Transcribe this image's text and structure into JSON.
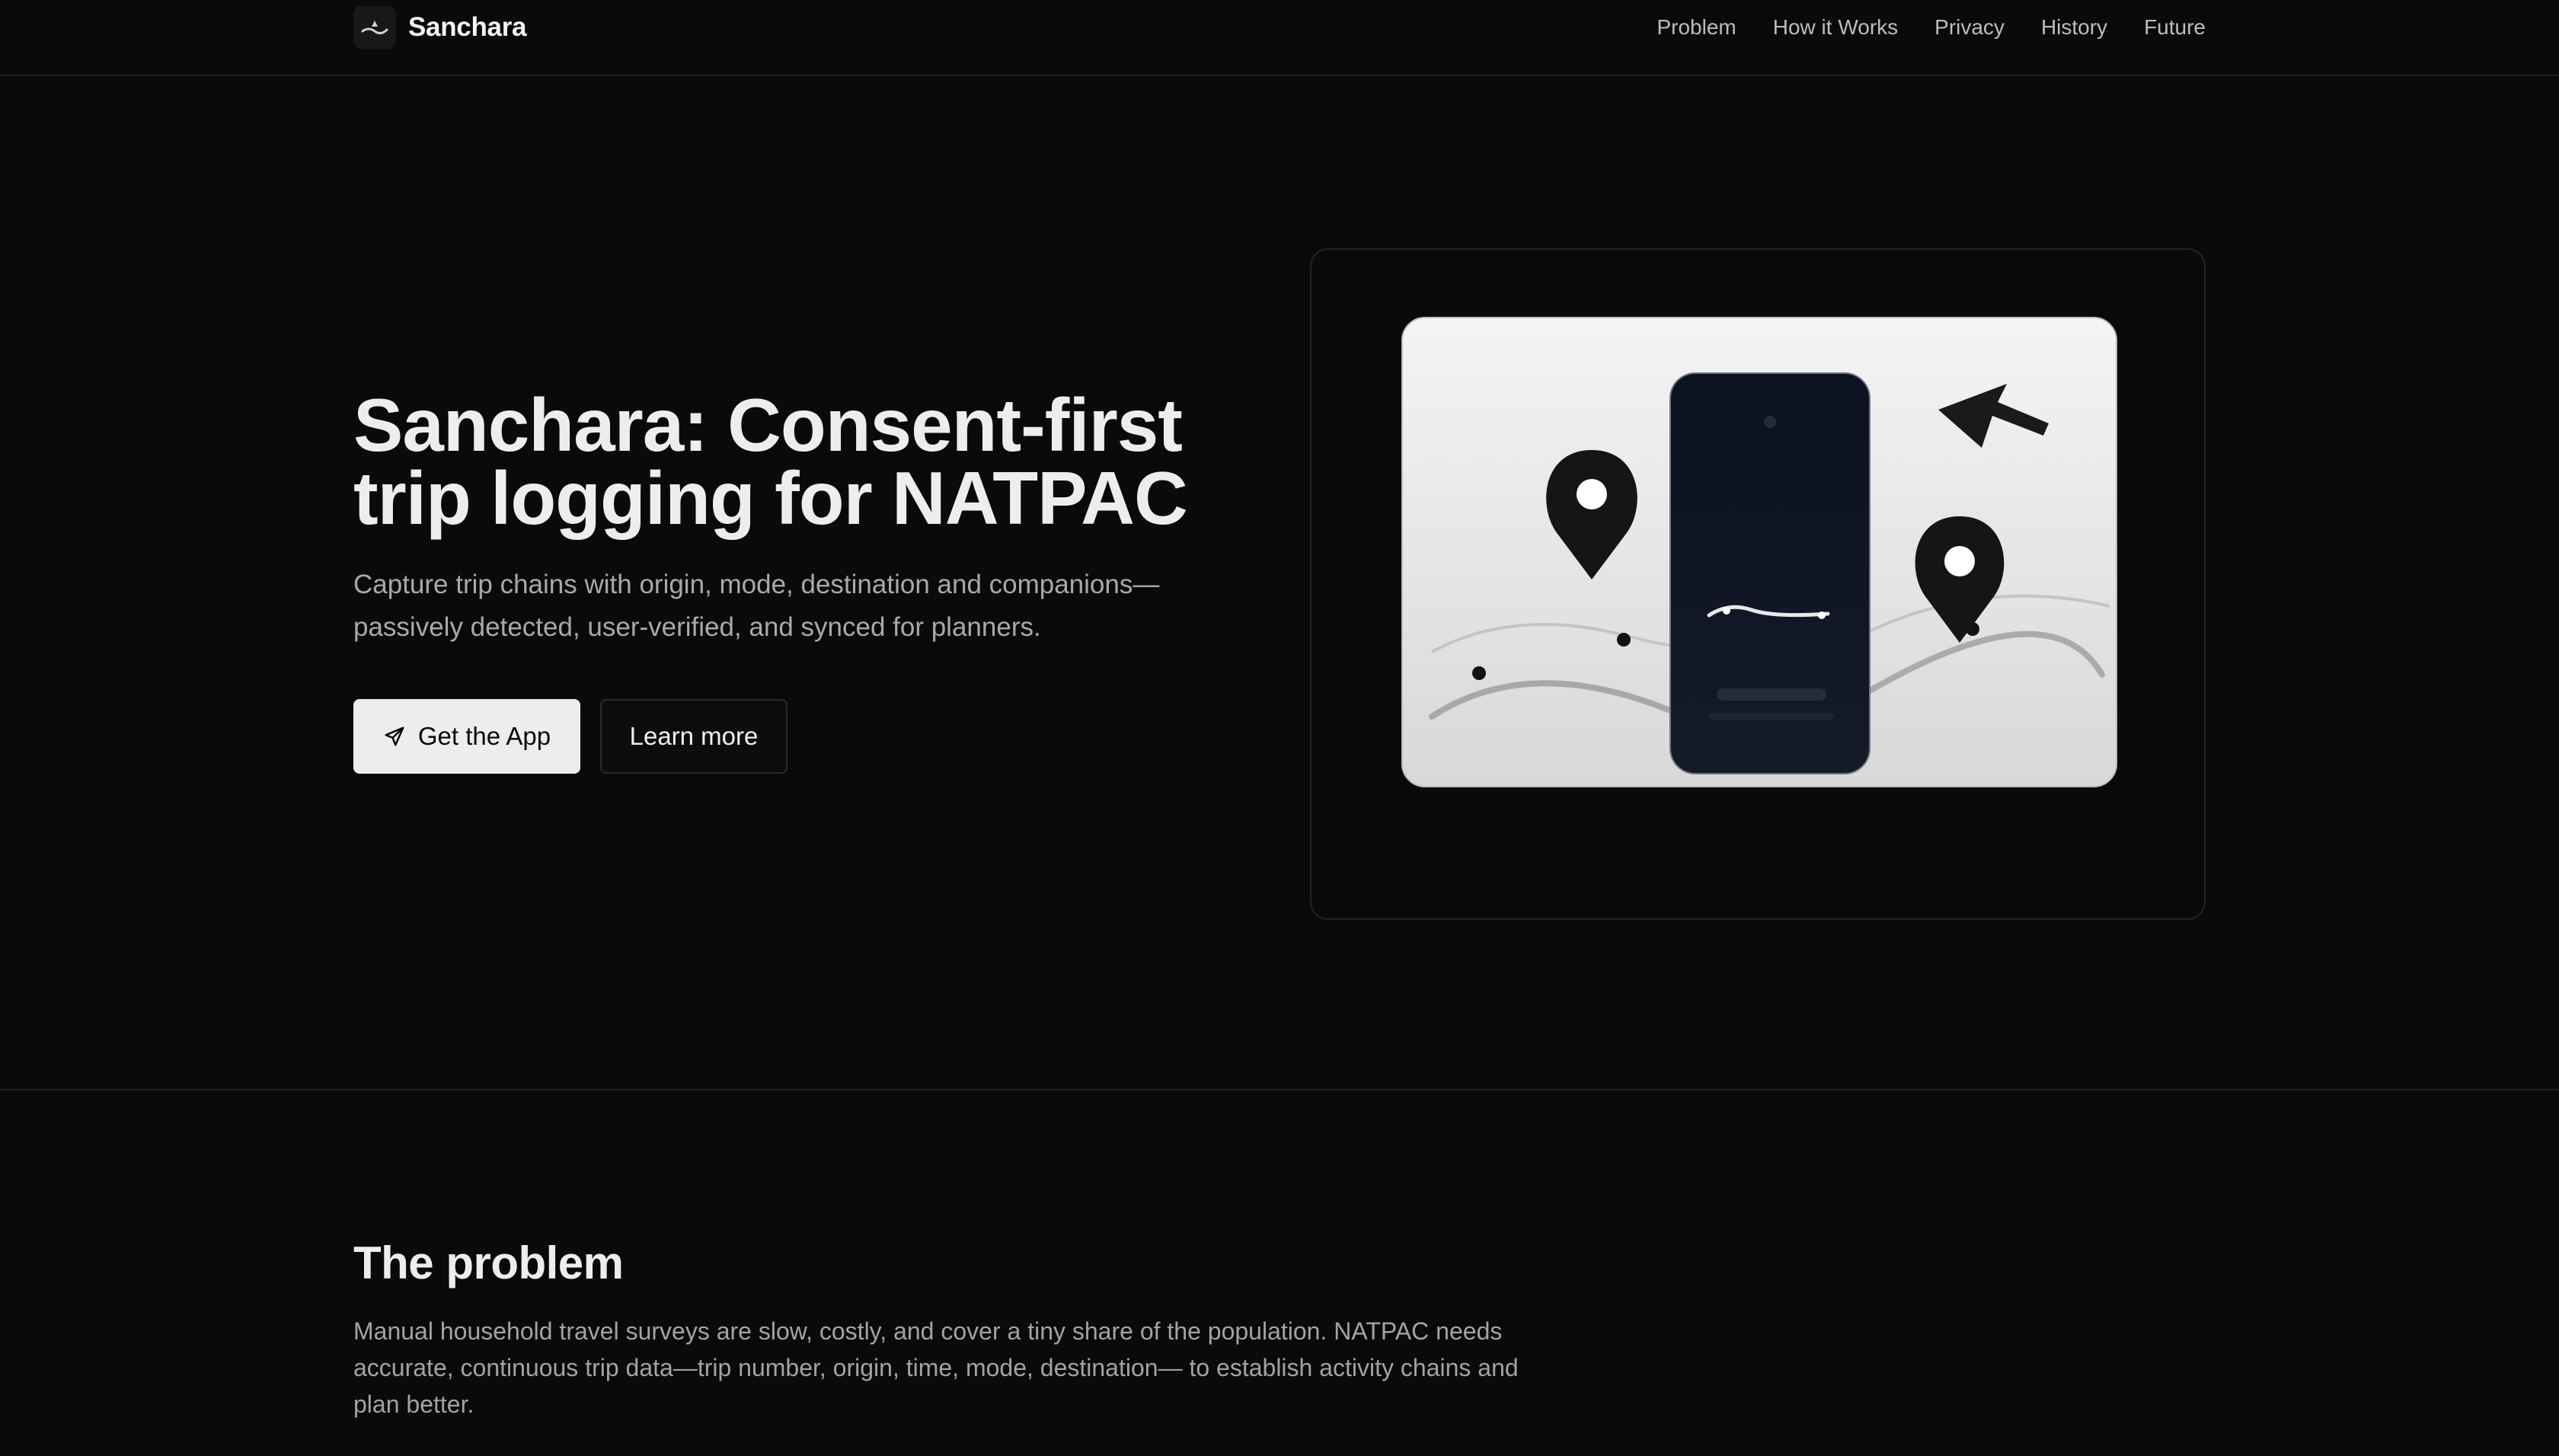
{
  "brand": {
    "name": "Sanchara",
    "logo_icon": "route-wave-icon"
  },
  "nav": {
    "items": [
      {
        "label": "Problem"
      },
      {
        "label": "How it Works"
      },
      {
        "label": "Privacy"
      },
      {
        "label": "History"
      },
      {
        "label": "Future"
      }
    ]
  },
  "hero": {
    "title": "Sanchara: Consent-first trip logging for NATPAC",
    "subtitle": "Capture trip chains with origin, mode, destination and companions—passively detected, user-verified, and synced for planners.",
    "primary_cta": {
      "label": "Get the App",
      "icon": "send-icon"
    },
    "secondary_cta": {
      "label": "Learn more"
    },
    "illustration": {
      "icons": [
        "map-pin-icon",
        "map-pin-icon",
        "cursor-arrow-icon",
        "phone-icon"
      ]
    }
  },
  "problem": {
    "heading": "The problem",
    "text": "Manual household travel surveys are slow, costly, and cover a tiny share of the population. NATPAC needs accurate, continuous trip data—trip number, origin, time, mode, destination— to establish activity chains and plan better."
  },
  "colors": {
    "background": "#0a0a0a",
    "text": "#ededed",
    "muted": "#a3a3a3",
    "primary_button_bg": "#ededed",
    "phone": "#0f1422"
  }
}
